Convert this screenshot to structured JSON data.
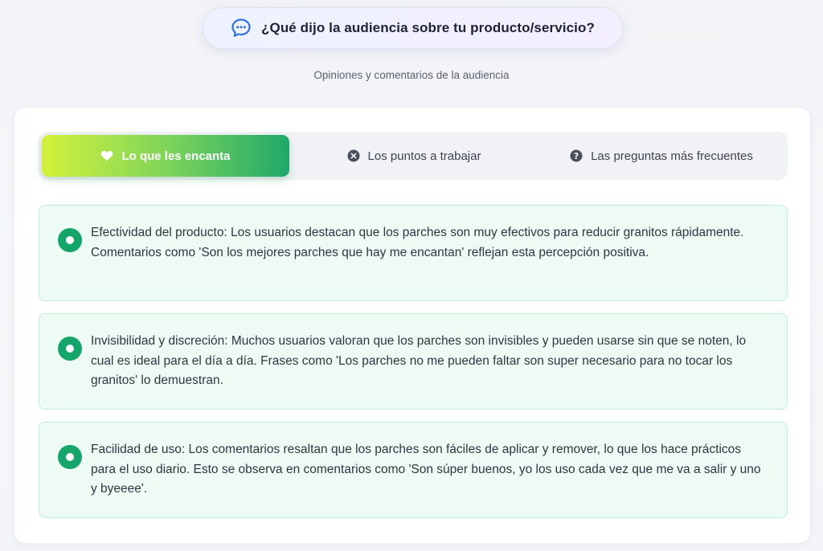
{
  "header": {
    "title": "¿Qué dijo la audiencia sobre tu producto/servicio?",
    "subtitle": "Opiniones y comentarios de la audiencia"
  },
  "tabs": [
    {
      "label": "Lo que les encanta",
      "icon": "heart-icon",
      "active": true
    },
    {
      "label": "Los puntos a trabajar",
      "icon": "x-circle-icon",
      "active": false
    },
    {
      "label": "Las preguntas más frecuentes",
      "icon": "question-circle-icon",
      "active": false
    }
  ],
  "items": [
    {
      "text": "Efectividad del producto: Los usuarios destacan que los parches son muy efectivos para reducir granitos rápidamente. Comentarios como 'Son los mejores parches que hay me encantan' reflejan esta percepción positiva."
    },
    {
      "text": "Invisibilidad y discreción: Muchos usuarios valoran que los parches son invisibles y pueden usarse sin que se noten, lo cual es ideal para el día a día. Frases como 'Los parches no me pueden faltar son super necesario para no tocar los granitos' lo demuestran."
    },
    {
      "text": "Facilidad de uso: Los comentarios resaltan que los parches son fáciles de aplicar y remover, lo que los hace prácticos para el uso diario. Esto se observa en comentarios como 'Son súper buenos, yo los uso cada vez que me va a salir y uno y byeeee'."
    }
  ],
  "colors": {
    "accent_green": "#15a56a",
    "tab_gradient_start": "#d4f13a",
    "tab_gradient_end": "#1fa86b",
    "item_bg": "#eefbf4",
    "icon_blue": "#2f6fe0"
  }
}
